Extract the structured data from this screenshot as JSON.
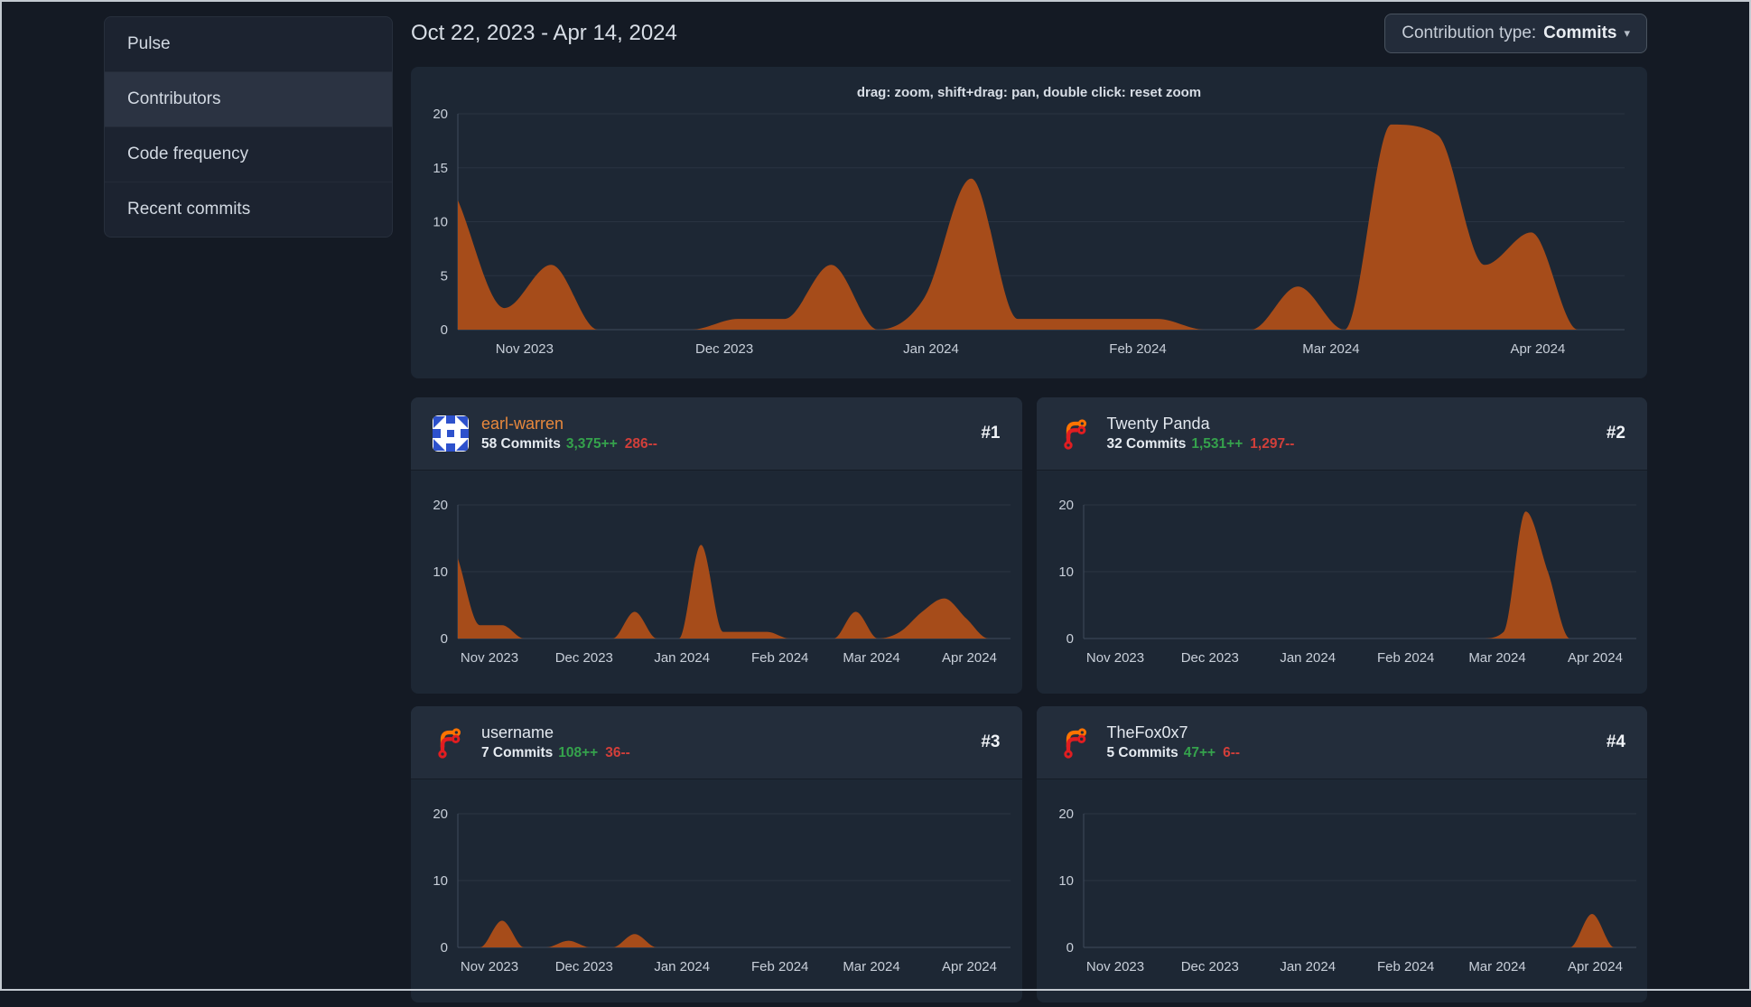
{
  "sidebar": {
    "items": [
      {
        "label": "Pulse",
        "selected": false
      },
      {
        "label": "Contributors",
        "selected": true
      },
      {
        "label": "Code frequency",
        "selected": false
      },
      {
        "label": "Recent commits",
        "selected": false
      }
    ]
  },
  "header": {
    "date_range": "Oct 22, 2023 - Apr 14, 2024",
    "contribution_type_label": "Contribution type:",
    "contribution_type_value": "Commits",
    "caret": "▾"
  },
  "main_chart": {
    "hint": "drag: zoom, shift+drag: pan, double click: reset zoom"
  },
  "contributors": [
    {
      "rank": "#1",
      "name": "earl-warren",
      "is_link": true,
      "avatar": "identicon",
      "commits": "58 Commits",
      "additions": "3,375++",
      "deletions": "286--"
    },
    {
      "rank": "#2",
      "name": "Twenty Panda",
      "is_link": false,
      "avatar": "forgejo-logo",
      "commits": "32 Commits",
      "additions": "1,531++",
      "deletions": "1,297--"
    },
    {
      "rank": "#3",
      "name": "username",
      "is_link": false,
      "avatar": "forgejo-logo",
      "commits": "7 Commits",
      "additions": "108++",
      "deletions": "36--"
    },
    {
      "rank": "#4",
      "name": "TheFox0x7",
      "is_link": false,
      "avatar": "forgejo-logo",
      "commits": "5 Commits",
      "additions": "47++",
      "deletions": "6--"
    }
  ],
  "chart_data": {
    "type": "area",
    "x_unit": "weeks since Oct 22, 2023",
    "x_range": [
      0,
      25
    ],
    "grid": "on",
    "month_ticks": [
      {
        "label": "Nov 2023",
        "week": 1.43
      },
      {
        "label": "Dec 2023",
        "week": 5.71
      },
      {
        "label": "Jan 2024",
        "week": 10.14
      },
      {
        "label": "Feb 2024",
        "week": 14.57
      },
      {
        "label": "Mar 2024",
        "week": 18.71
      },
      {
        "label": "Apr 2024",
        "week": 23.14
      }
    ],
    "style": {
      "fill": "#a64c1a",
      "grid_line": "#2a3442",
      "axis_line": "#404b5c",
      "tick_text": "#c8cfd9"
    },
    "main": {
      "title": "weekly commits, all contributors",
      "y_ticks": [
        0,
        5,
        10,
        15,
        20
      ],
      "y_max": 20,
      "values": [
        12,
        2,
        6,
        0,
        0,
        0,
        1,
        1,
        6,
        0,
        3,
        14,
        1,
        1,
        1,
        1,
        0,
        0,
        4,
        0,
        19,
        18,
        6,
        9,
        0,
        0
      ]
    },
    "per_contributor": [
      {
        "name": "earl-warren",
        "y_ticks": [
          0,
          10,
          20
        ],
        "y_max": 20,
        "values": [
          12,
          2,
          2,
          0,
          0,
          0,
          0,
          0,
          4,
          0,
          0,
          14,
          1,
          1,
          1,
          0,
          0,
          0,
          4,
          0,
          1,
          4,
          6,
          3,
          0,
          0
        ]
      },
      {
        "name": "Twenty Panda",
        "y_ticks": [
          0,
          10,
          20
        ],
        "y_max": 20,
        "values": [
          0,
          0,
          0,
          0,
          0,
          0,
          0,
          0,
          0,
          0,
          0,
          0,
          0,
          0,
          0,
          0,
          0,
          0,
          0,
          1,
          19,
          10,
          0,
          0,
          0,
          0
        ]
      },
      {
        "name": "username",
        "y_ticks": [
          0,
          10,
          20
        ],
        "y_max": 20,
        "values": [
          0,
          0,
          4,
          0,
          0,
          1,
          0,
          0,
          2,
          0,
          0,
          0,
          0,
          0,
          0,
          0,
          0,
          0,
          0,
          0,
          0,
          0,
          0,
          0,
          0,
          0
        ]
      },
      {
        "name": "TheFox0x7",
        "y_ticks": [
          0,
          10,
          20
        ],
        "y_max": 20,
        "values": [
          0,
          0,
          0,
          0,
          0,
          0,
          0,
          0,
          0,
          0,
          0,
          0,
          0,
          0,
          0,
          0,
          0,
          0,
          0,
          0,
          0,
          0,
          0,
          5,
          0,
          0
        ]
      }
    ]
  }
}
